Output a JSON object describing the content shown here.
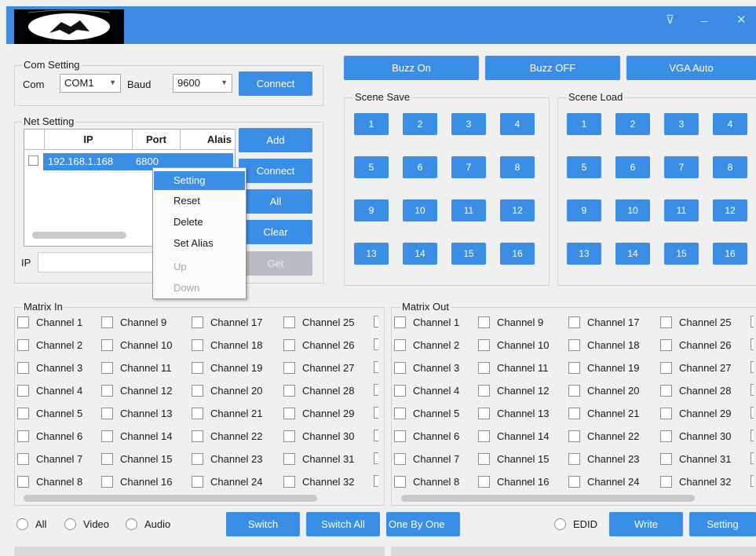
{
  "title_controls": {
    "restore": "⊽",
    "minimize": "_",
    "close": "✕"
  },
  "com_setting": {
    "group_label": "Com Setting",
    "com_label": "Com",
    "com_value": "COM1",
    "baud_label": "Baud",
    "baud_value": "9600",
    "connect": "Connect"
  },
  "top_buttons": [
    "Buzz On",
    "Buzz OFF",
    "VGA Auto"
  ],
  "net_setting": {
    "group_label": "Net Setting",
    "columns": [
      "IP",
      "Port",
      "Alais"
    ],
    "row": {
      "ip": "192.168.1.168",
      "port": "6800",
      "alias": ""
    },
    "buttons": [
      "Add",
      "Connect",
      "All",
      "Clear",
      "Get"
    ],
    "ip_label": "IP"
  },
  "context_menu": [
    "Setting",
    "Reset",
    "Delete",
    "Set Alias",
    "Up",
    "Down"
  ],
  "scene_save": {
    "label": "Scene Save",
    "buttons": [
      "1",
      "2",
      "3",
      "4",
      "5",
      "6",
      "7",
      "8",
      "9",
      "10",
      "11",
      "12",
      "13",
      "14",
      "15",
      "16"
    ]
  },
  "scene_load": {
    "label": "Scene Load",
    "buttons": [
      "1",
      "2",
      "3",
      "4",
      "5",
      "6",
      "7",
      "8",
      "9",
      "10",
      "11",
      "12",
      "13",
      "14",
      "15",
      "16"
    ]
  },
  "matrix_in": {
    "label": "Matrix In"
  },
  "matrix_out": {
    "label": "Matrix Out"
  },
  "channels": [
    [
      "Channel 1",
      "Channel 9",
      "Channel 17",
      "Channel 25"
    ],
    [
      "Channel 2",
      "Channel 10",
      "Channel 18",
      "Channel 26"
    ],
    [
      "Channel 3",
      "Channel 11",
      "Channel 19",
      "Channel 27"
    ],
    [
      "Channel 4",
      "Channel 12",
      "Channel 20",
      "Channel 28"
    ],
    [
      "Channel 5",
      "Channel 13",
      "Channel 21",
      "Channel 29"
    ],
    [
      "Channel 6",
      "Channel 14",
      "Channel 22",
      "Channel 30"
    ],
    [
      "Channel 7",
      "Channel 15",
      "Channel 23",
      "Channel 31"
    ],
    [
      "Channel 8",
      "Channel 16",
      "Channel 24",
      "Channel 32"
    ]
  ],
  "bottom": {
    "radio_all": "All",
    "radio_video": "Video",
    "radio_audio": "Audio",
    "switch": "Switch",
    "switch_all": "Switch All",
    "one_by_one": "One By One",
    "edid": "EDID",
    "write": "Write",
    "setting": "Setting"
  },
  "colors": {
    "accent": "#3b8ee5",
    "titlebar": "#3d8ae3",
    "background": "#f0f0f0",
    "disabled": "#b9bcc0"
  }
}
